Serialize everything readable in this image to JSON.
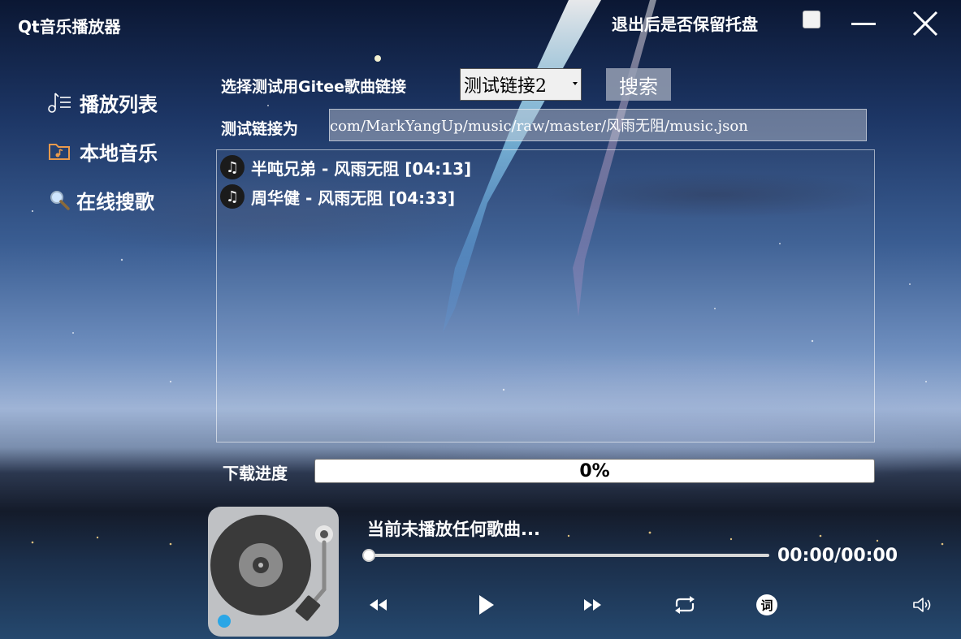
{
  "app": {
    "title": "Qt音乐播放器"
  },
  "titlebar": {
    "tray_label": "退出后是否保留托盘",
    "tray_checked": false
  },
  "sidebar": {
    "items": [
      {
        "label": "播放列表",
        "icon": "playlist-icon"
      },
      {
        "label": "本地音乐",
        "icon": "folder-music-icon"
      },
      {
        "label": "在线搜歌",
        "icon": "search-icon"
      }
    ]
  },
  "search": {
    "label": "选择测试用Gitee歌曲链接",
    "selected_link": "测试链接2",
    "button": "搜索",
    "url_label": "测试链接为",
    "url_value": "com/MarkYangUp/music/raw/master/风雨无阻/music.json"
  },
  "songs": [
    {
      "title": "半吨兄弟 - 风雨无阻 [04:13]"
    },
    {
      "title": "周华健 - 风雨无阻 [04:33]"
    }
  ],
  "download": {
    "label": "下载进度",
    "percent": 0,
    "percent_text": "0%",
    "bar_color": "#2b74d6"
  },
  "player": {
    "now_playing": "当前未播放任何歌曲...",
    "time": "00:00/00:00",
    "progress": 0,
    "controls": [
      "rewind-icon",
      "play-icon",
      "fast-forward-icon",
      "repeat-icon",
      "lyrics-icon",
      "volume-icon"
    ],
    "lyrics_glyph": "词"
  }
}
